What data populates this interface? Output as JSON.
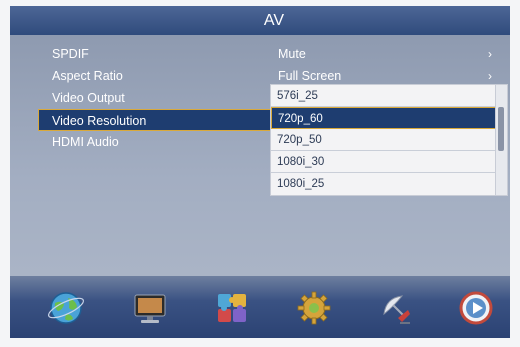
{
  "window": {
    "title": "AV"
  },
  "menu": {
    "items": [
      {
        "label": "SPDIF",
        "value": "Mute",
        "arrow": "›"
      },
      {
        "label": "Aspect Ratio",
        "value": "Full Screen",
        "arrow": "›"
      },
      {
        "label": "Video Output",
        "value": "",
        "arrow": ""
      },
      {
        "label": "Video Resolution",
        "value": "",
        "arrow": ""
      },
      {
        "label": "HDMI Audio",
        "value": "",
        "arrow": ""
      }
    ],
    "selected_label": "Video Resolution"
  },
  "dropdown": {
    "options": [
      "576i_25",
      "720p_60",
      "720p_50",
      "1080i_30",
      "1080i_25"
    ],
    "selected": "720p_60"
  },
  "bottom_nav": {
    "icons": [
      "globe-icon",
      "tv-monitor-icon",
      "puzzle-icon",
      "gear-icon",
      "satellite-dish-icon",
      "media-play-icon"
    ]
  },
  "colors": {
    "title_bar": "#3a5585",
    "selection": "#1e3d70",
    "selection_border": "#d9a93a",
    "panel": "#98a3b7"
  }
}
